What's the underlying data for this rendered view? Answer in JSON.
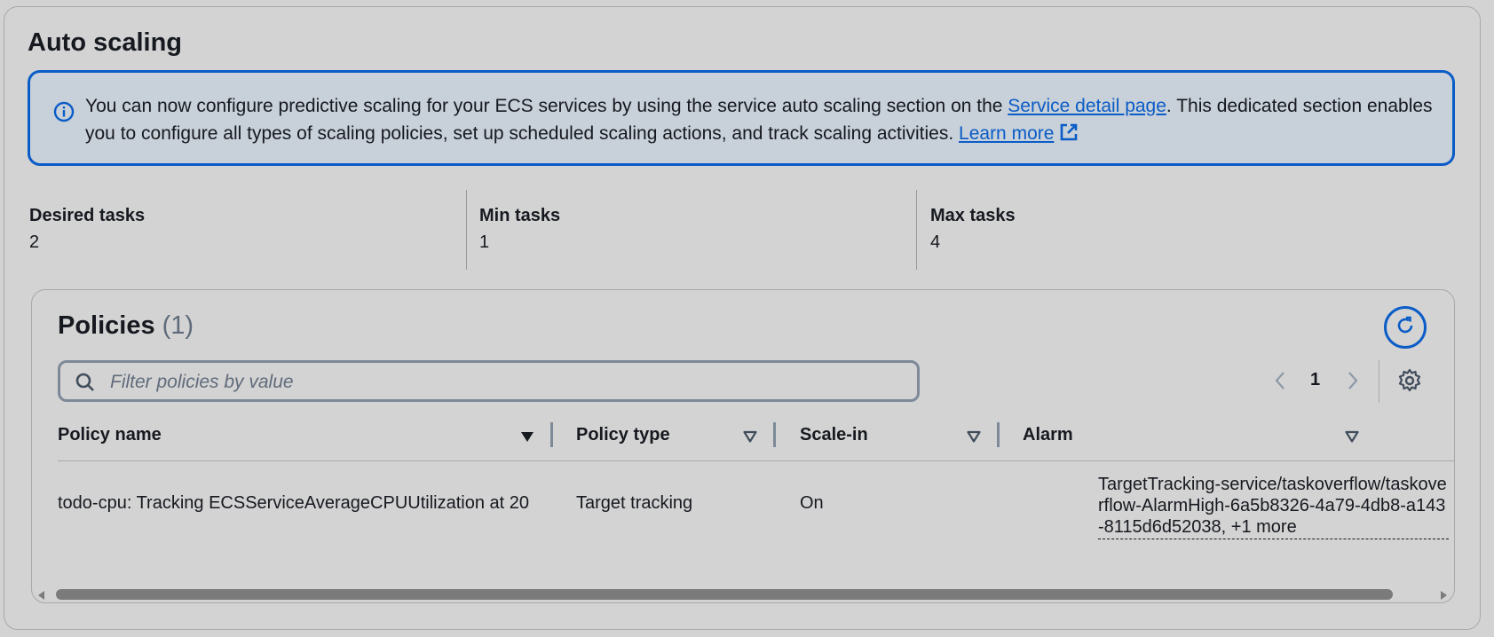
{
  "section": {
    "title": "Auto scaling"
  },
  "alert": {
    "text_before": "You can now configure predictive scaling for your ECS services by using the service auto scaling section on the ",
    "link1": "Service detail page",
    "text_middle": ". This dedicated section enables you to configure all types of scaling policies, set up scheduled scaling actions, and track scaling activities. ",
    "link2": "Learn more",
    "icon": "info-icon",
    "link_icon": "external-link-icon"
  },
  "stats": [
    {
      "label": "Desired tasks",
      "value": "2"
    },
    {
      "label": "Min tasks",
      "value": "1"
    },
    {
      "label": "Max tasks",
      "value": "4"
    }
  ],
  "policies": {
    "title": "Policies",
    "count": "(1)",
    "filter_placeholder": "Filter policies by value",
    "page": "1",
    "columns": [
      "Policy name",
      "Policy type",
      "Scale-in",
      "Alarm"
    ],
    "rows": [
      {
        "name": "todo-cpu: Tracking ECSServiceAverageCPUUtilization at 20",
        "type": "Target tracking",
        "scale_in": "On",
        "alarm": "TargetTracking-service/taskoverflow/taskoverflow-AlarmHigh-6a5b8326-4a79-4db8-a143-8115d6d52038, +1 more"
      }
    ]
  },
  "colors": {
    "accent": "#0a5cc7",
    "background": "#d3d3d3",
    "alert_bg": "#c8d0d9"
  }
}
